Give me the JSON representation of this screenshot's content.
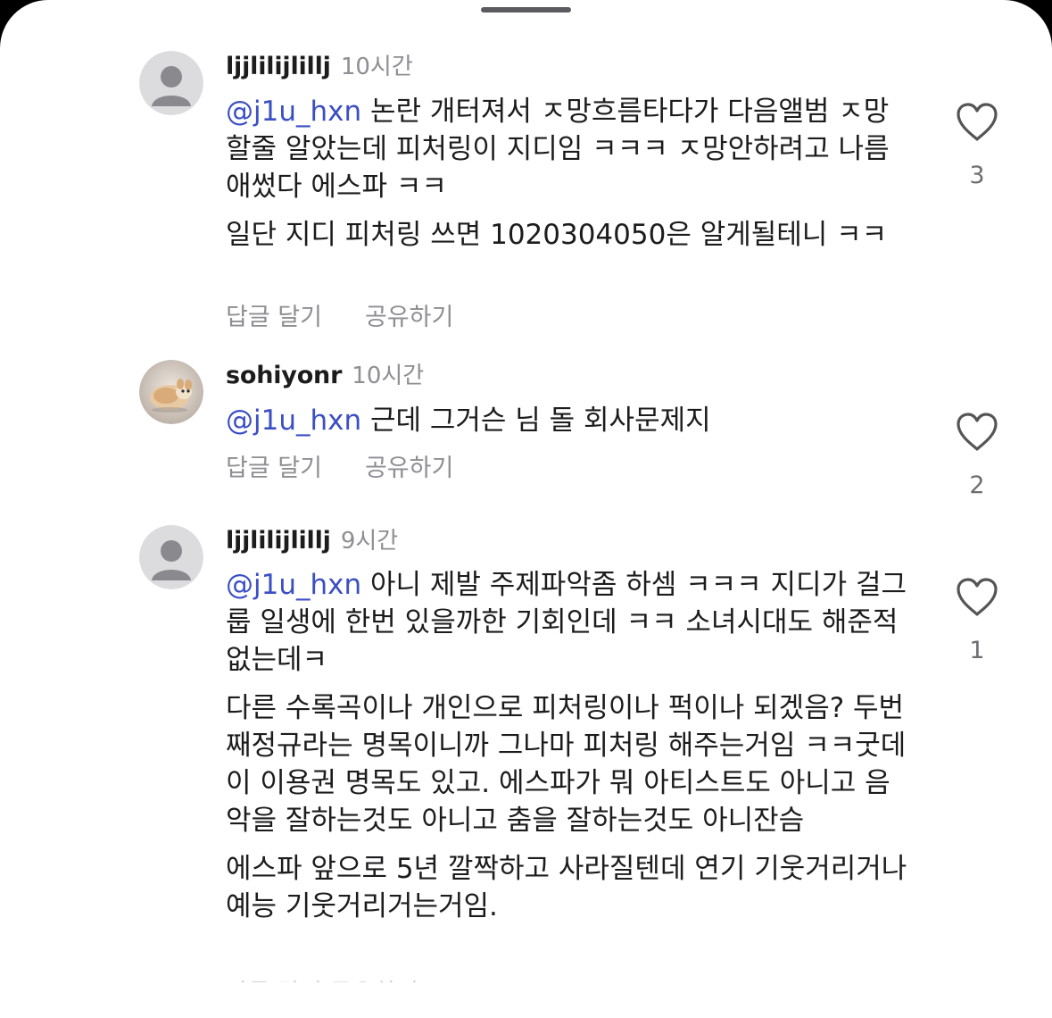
{
  "sheet": {
    "grabber_icon": "drag-handle"
  },
  "comments": [
    {
      "username": "ljjlilijlillj",
      "time": "10시간",
      "avatar": "default-avatar-icon",
      "mention": "@j1u_hxn",
      "paragraphs": [
        " 논란 개터져서 ㅈ망흐름타다가 다음앨범 ㅈ망할줄 알았는데 피처링이 지디임 ㅋㅋㅋ ㅈ망안하려고 나름 애썼다 에스파 ㅋㅋ",
        "일단 지디 피처링 쓰면 1020304050은 알게될테니 ㅋㅋ"
      ],
      "reply_label": "답글 달기",
      "share_label": "공유하기",
      "like_count": "3"
    },
    {
      "username": "sohiyonr",
      "time": "10시간",
      "avatar": "hamster-photo-avatar",
      "mention": "@j1u_hxn",
      "paragraphs": [
        " 근데 그거슨 님 돌 회사문제지"
      ],
      "reply_label": "답글 달기",
      "share_label": "공유하기",
      "like_count": "2"
    },
    {
      "username": "ljjlilijlillj",
      "time": "9시간",
      "avatar": "default-avatar-icon",
      "mention": "@j1u_hxn",
      "paragraphs": [
        " 아니 제발 주제파악좀 하셈 ㅋㅋㅋ 지디가 걸그룹 일생에 한번 있을까한 기회인데 ㅋㅋ 소녀시대도 해준적없는데ㅋ",
        "다른 수록곡이나 개인으로 피처링이나 퍽이나 되겠음? 두번째정규라는 명목이니까 그나마 피처링 해주는거임 ㅋㅋ굿데이 이용권 명목도 있고. 에스파가 뭐 아티스트도 아니고 음악을 잘하는것도 아니고 춤을 잘하는것도 아니잔슴",
        "에스파 앞으로 5년 깔짝하고 사라질텐데 연기 기웃거리거나 예능 기웃거리거는거임."
      ],
      "reply_label": "답글 달기",
      "share_label": "공유하기",
      "like_count": "1"
    }
  ],
  "peek_text": "답글 달기   공유하기",
  "colors": {
    "mention": "#3b4fc4",
    "secondary_text": "#8e8e93",
    "primary_text": "#1c1c1e",
    "background": "#ffffff"
  },
  "icons": {
    "like": "heart-outline-icon"
  }
}
